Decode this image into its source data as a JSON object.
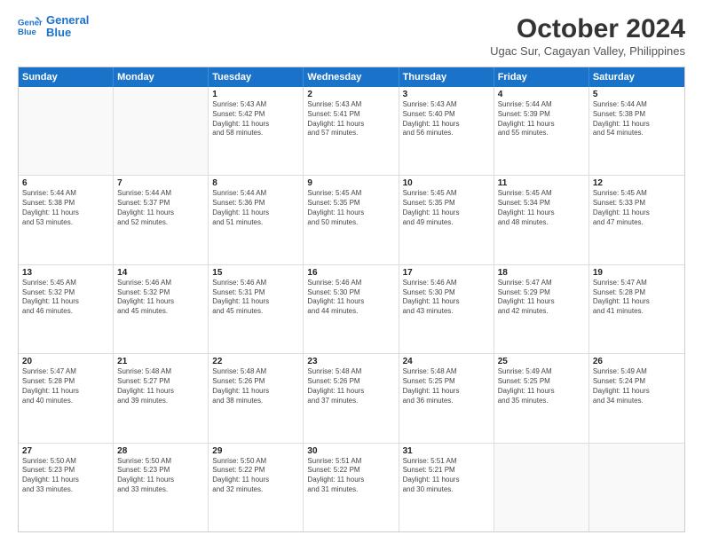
{
  "header": {
    "logo_line1": "General",
    "logo_line2": "Blue",
    "month": "October 2024",
    "location": "Ugac Sur, Cagayan Valley, Philippines"
  },
  "weekdays": [
    "Sunday",
    "Monday",
    "Tuesday",
    "Wednesday",
    "Thursday",
    "Friday",
    "Saturday"
  ],
  "weeks": [
    [
      {
        "day": "",
        "lines": []
      },
      {
        "day": "",
        "lines": []
      },
      {
        "day": "1",
        "lines": [
          "Sunrise: 5:43 AM",
          "Sunset: 5:42 PM",
          "Daylight: 11 hours",
          "and 58 minutes."
        ]
      },
      {
        "day": "2",
        "lines": [
          "Sunrise: 5:43 AM",
          "Sunset: 5:41 PM",
          "Daylight: 11 hours",
          "and 57 minutes."
        ]
      },
      {
        "day": "3",
        "lines": [
          "Sunrise: 5:43 AM",
          "Sunset: 5:40 PM",
          "Daylight: 11 hours",
          "and 56 minutes."
        ]
      },
      {
        "day": "4",
        "lines": [
          "Sunrise: 5:44 AM",
          "Sunset: 5:39 PM",
          "Daylight: 11 hours",
          "and 55 minutes."
        ]
      },
      {
        "day": "5",
        "lines": [
          "Sunrise: 5:44 AM",
          "Sunset: 5:38 PM",
          "Daylight: 11 hours",
          "and 54 minutes."
        ]
      }
    ],
    [
      {
        "day": "6",
        "lines": [
          "Sunrise: 5:44 AM",
          "Sunset: 5:38 PM",
          "Daylight: 11 hours",
          "and 53 minutes."
        ]
      },
      {
        "day": "7",
        "lines": [
          "Sunrise: 5:44 AM",
          "Sunset: 5:37 PM",
          "Daylight: 11 hours",
          "and 52 minutes."
        ]
      },
      {
        "day": "8",
        "lines": [
          "Sunrise: 5:44 AM",
          "Sunset: 5:36 PM",
          "Daylight: 11 hours",
          "and 51 minutes."
        ]
      },
      {
        "day": "9",
        "lines": [
          "Sunrise: 5:45 AM",
          "Sunset: 5:35 PM",
          "Daylight: 11 hours",
          "and 50 minutes."
        ]
      },
      {
        "day": "10",
        "lines": [
          "Sunrise: 5:45 AM",
          "Sunset: 5:35 PM",
          "Daylight: 11 hours",
          "and 49 minutes."
        ]
      },
      {
        "day": "11",
        "lines": [
          "Sunrise: 5:45 AM",
          "Sunset: 5:34 PM",
          "Daylight: 11 hours",
          "and 48 minutes."
        ]
      },
      {
        "day": "12",
        "lines": [
          "Sunrise: 5:45 AM",
          "Sunset: 5:33 PM",
          "Daylight: 11 hours",
          "and 47 minutes."
        ]
      }
    ],
    [
      {
        "day": "13",
        "lines": [
          "Sunrise: 5:45 AM",
          "Sunset: 5:32 PM",
          "Daylight: 11 hours",
          "and 46 minutes."
        ]
      },
      {
        "day": "14",
        "lines": [
          "Sunrise: 5:46 AM",
          "Sunset: 5:32 PM",
          "Daylight: 11 hours",
          "and 45 minutes."
        ]
      },
      {
        "day": "15",
        "lines": [
          "Sunrise: 5:46 AM",
          "Sunset: 5:31 PM",
          "Daylight: 11 hours",
          "and 45 minutes."
        ]
      },
      {
        "day": "16",
        "lines": [
          "Sunrise: 5:46 AM",
          "Sunset: 5:30 PM",
          "Daylight: 11 hours",
          "and 44 minutes."
        ]
      },
      {
        "day": "17",
        "lines": [
          "Sunrise: 5:46 AM",
          "Sunset: 5:30 PM",
          "Daylight: 11 hours",
          "and 43 minutes."
        ]
      },
      {
        "day": "18",
        "lines": [
          "Sunrise: 5:47 AM",
          "Sunset: 5:29 PM",
          "Daylight: 11 hours",
          "and 42 minutes."
        ]
      },
      {
        "day": "19",
        "lines": [
          "Sunrise: 5:47 AM",
          "Sunset: 5:28 PM",
          "Daylight: 11 hours",
          "and 41 minutes."
        ]
      }
    ],
    [
      {
        "day": "20",
        "lines": [
          "Sunrise: 5:47 AM",
          "Sunset: 5:28 PM",
          "Daylight: 11 hours",
          "and 40 minutes."
        ]
      },
      {
        "day": "21",
        "lines": [
          "Sunrise: 5:48 AM",
          "Sunset: 5:27 PM",
          "Daylight: 11 hours",
          "and 39 minutes."
        ]
      },
      {
        "day": "22",
        "lines": [
          "Sunrise: 5:48 AM",
          "Sunset: 5:26 PM",
          "Daylight: 11 hours",
          "and 38 minutes."
        ]
      },
      {
        "day": "23",
        "lines": [
          "Sunrise: 5:48 AM",
          "Sunset: 5:26 PM",
          "Daylight: 11 hours",
          "and 37 minutes."
        ]
      },
      {
        "day": "24",
        "lines": [
          "Sunrise: 5:48 AM",
          "Sunset: 5:25 PM",
          "Daylight: 11 hours",
          "and 36 minutes."
        ]
      },
      {
        "day": "25",
        "lines": [
          "Sunrise: 5:49 AM",
          "Sunset: 5:25 PM",
          "Daylight: 11 hours",
          "and 35 minutes."
        ]
      },
      {
        "day": "26",
        "lines": [
          "Sunrise: 5:49 AM",
          "Sunset: 5:24 PM",
          "Daylight: 11 hours",
          "and 34 minutes."
        ]
      }
    ],
    [
      {
        "day": "27",
        "lines": [
          "Sunrise: 5:50 AM",
          "Sunset: 5:23 PM",
          "Daylight: 11 hours",
          "and 33 minutes."
        ]
      },
      {
        "day": "28",
        "lines": [
          "Sunrise: 5:50 AM",
          "Sunset: 5:23 PM",
          "Daylight: 11 hours",
          "and 33 minutes."
        ]
      },
      {
        "day": "29",
        "lines": [
          "Sunrise: 5:50 AM",
          "Sunset: 5:22 PM",
          "Daylight: 11 hours",
          "and 32 minutes."
        ]
      },
      {
        "day": "30",
        "lines": [
          "Sunrise: 5:51 AM",
          "Sunset: 5:22 PM",
          "Daylight: 11 hours",
          "and 31 minutes."
        ]
      },
      {
        "day": "31",
        "lines": [
          "Sunrise: 5:51 AM",
          "Sunset: 5:21 PM",
          "Daylight: 11 hours",
          "and 30 minutes."
        ]
      },
      {
        "day": "",
        "lines": []
      },
      {
        "day": "",
        "lines": []
      }
    ]
  ]
}
